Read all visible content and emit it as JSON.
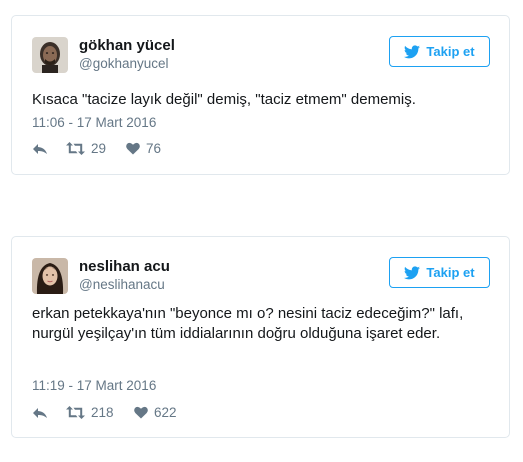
{
  "tweets": [
    {
      "name": "gökhan yücel",
      "handle": "@gokhanyucel",
      "follow_label": "Takip et",
      "text": "Kısaca \"tacize layık değil\" demiş, \"taciz etmem\" dememiş.",
      "timestamp": "11:06 - 17 Mart 2016",
      "retweets": "29",
      "likes": "76",
      "avatar_icon": "profile-photo"
    },
    {
      "name": "neslihan acu",
      "handle": "@neslihanacu",
      "follow_label": "Takip et",
      "text": "erkan petekkaya'nın \"beyonce mı o? nesini taciz edeceğim?\" lafı, nurgül yeşilçay'ın tüm iddialarının doğru olduğuna işaret eder.",
      "timestamp": "11:19 - 17 Mart 2016",
      "retweets": "218",
      "likes": "622",
      "avatar_icon": "profile-photo"
    }
  ],
  "colors": {
    "accent": "#1da1f2",
    "secondary_text": "#657786",
    "primary_text": "#14171a",
    "border": "#e1e8ed"
  }
}
